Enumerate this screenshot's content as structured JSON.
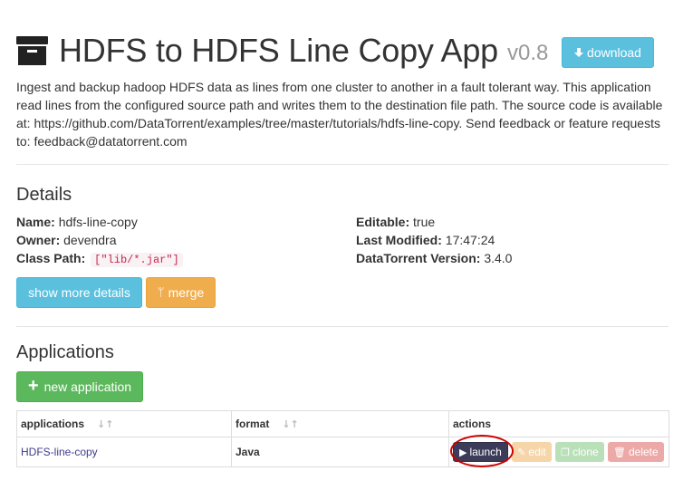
{
  "header": {
    "title": "HDFS to HDFS Line Copy App",
    "version": "v0.8",
    "download_label": "download"
  },
  "description": "Ingest and backup hadoop HDFS data as lines from one cluster to another in a fault tolerant way. This application read lines from the configured source path and writes them to the destination file path. The source code is available at: https://github.com/DataTorrent/examples/tree/master/tutorials/hdfs-line-copy. Send feedback or feature requests to: feedback@datatorrent.com",
  "details": {
    "title": "Details",
    "name_label": "Name:",
    "name_value": "hdfs-line-copy",
    "owner_label": "Owner:",
    "owner_value": "devendra",
    "classpath_label": "Class Path:",
    "classpath_value": "[\"lib/*.jar\"]",
    "editable_label": "Editable:",
    "editable_value": "true",
    "modified_label": "Last Modified:",
    "modified_value": "17:47:24",
    "dt_version_label": "DataTorrent Version:",
    "dt_version_value": "3.4.0",
    "show_more_label": "show more details",
    "merge_label": "merge"
  },
  "applications": {
    "title": "Applications",
    "new_app_label": "new application",
    "columns": [
      "applications",
      "format",
      "actions"
    ],
    "rows": [
      {
        "name": "HDFS-line-copy",
        "format": "Java",
        "launch": "launch",
        "edit": "edit",
        "clone": "clone",
        "delete": "delete"
      }
    ]
  },
  "colors": {
    "info": "#5bc0de",
    "warning": "#f0ad4e",
    "success": "#5cb85c",
    "launch": "#3c3c5a",
    "highlight": "#cc0000"
  }
}
